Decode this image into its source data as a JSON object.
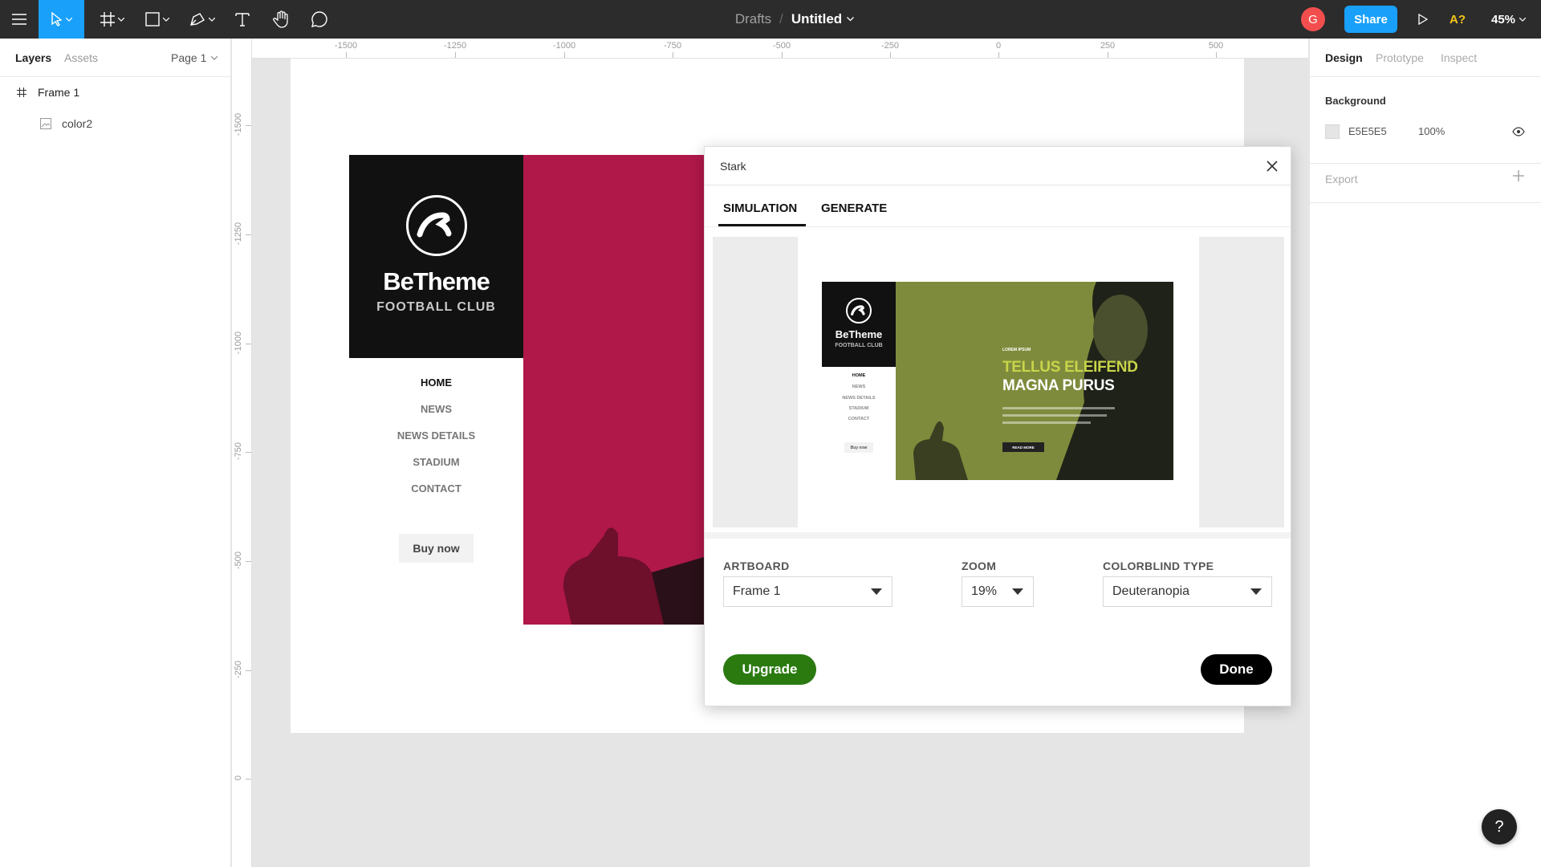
{
  "toolbar": {
    "breadcrumb": "Drafts",
    "separator": "/",
    "file_name": "Untitled",
    "avatar_initial": "G",
    "share_label": "Share",
    "a11y_label": "A?",
    "zoom_label": "45%"
  },
  "left_panel": {
    "tabs": [
      "Layers",
      "Assets"
    ],
    "page_selector": "Page 1",
    "layers": [
      {
        "name": "Frame 1",
        "icon": "frame-icon"
      },
      {
        "name": "color2",
        "icon": "image-icon"
      }
    ]
  },
  "rulers": {
    "top": [
      "-1500",
      "-1250",
      "-1000",
      "-750",
      "-500",
      "-250",
      "0",
      "250",
      "500"
    ],
    "left": [
      "-1500",
      "-1250",
      "-1000",
      "-750",
      "-500",
      "-250",
      "0"
    ]
  },
  "frame": {
    "brand": "BeTheme",
    "brand_sub": "FOOTBALL CLUB",
    "nav": [
      "HOME",
      "NEWS",
      "NEWS DETAILS",
      "STADIUM",
      "CONTACT"
    ],
    "buy_label": "Buy now",
    "accent": "#b0184a"
  },
  "stark": {
    "title": "Stark",
    "tabs": [
      "SIMULATION",
      "GENERATE"
    ],
    "preview": {
      "brand": "BeTheme",
      "brand_sub": "FOOTBALL CLUB",
      "nav": [
        "HOME",
        "NEWS",
        "NEWS DETAILS",
        "STADIUM",
        "CONTACT"
      ],
      "buy_label": "Buy now",
      "kicker": "LOREM IPSUM",
      "headline_1": "TELLUS ELEIFEND",
      "headline_2": "MAGNA PURUS",
      "button_label": "READ MORE"
    },
    "artboard_label": "ARTBOARD",
    "artboard_value": "Frame 1",
    "zoom_label": "ZOOM",
    "zoom_value": "19%",
    "colorblind_label": "COLORBLIND TYPE",
    "colorblind_value": "Deuteranopia",
    "upgrade_label": "Upgrade",
    "done_label": "Done",
    "upgrade_color": "#2a7a10"
  },
  "right_panel": {
    "tabs": [
      "Design",
      "Prototype",
      "Inspect"
    ],
    "background_title": "Background",
    "background_hex": "E5E5E5",
    "background_opacity": "100%",
    "export_label": "Export"
  },
  "help_label": "?"
}
